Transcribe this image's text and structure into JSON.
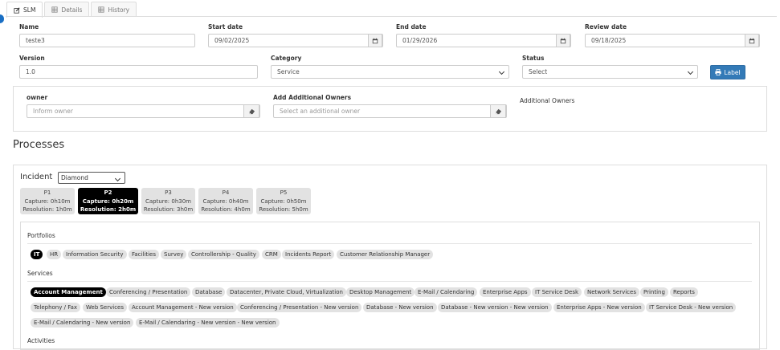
{
  "tabs": [
    {
      "label": "SLM",
      "icon": "edit-icon",
      "active": true
    },
    {
      "label": "Details",
      "icon": "list-icon",
      "active": false
    },
    {
      "label": "History",
      "icon": "list-icon",
      "active": false
    }
  ],
  "form": {
    "name": {
      "label": "Name",
      "value": "teste3"
    },
    "start_date": {
      "label": "Start date",
      "value": "09/02/2025"
    },
    "end_date": {
      "label": "End date",
      "value": "01/29/2026"
    },
    "review_date": {
      "label": "Review date",
      "value": "09/18/2025"
    },
    "version": {
      "label": "Version",
      "value": "1.0"
    },
    "category": {
      "label": "Category",
      "value": "Service"
    },
    "status": {
      "label": "Status",
      "value": "Select"
    },
    "label_button": "Label"
  },
  "owners": {
    "owner_label": "owner",
    "owner_placeholder": "Inform owner",
    "additional_label": "Add Additional Owners",
    "additional_placeholder": "Select an additional owner",
    "additional_owners_text": "Additional Owners"
  },
  "processes": {
    "title": "Processes",
    "incident_label": "Incident",
    "incident_select": "Diamond",
    "priorities": [
      {
        "name": "P1",
        "capture": "Capture: 0h10m",
        "resolution": "Resolution: 1h0m",
        "active": false
      },
      {
        "name": "P2",
        "capture": "Capture: 0h20m",
        "resolution": "Resolution: 2h0m",
        "active": true
      },
      {
        "name": "P3",
        "capture": "Capture: 0h30m",
        "resolution": "Resolution: 3h0m",
        "active": false
      },
      {
        "name": "P4",
        "capture": "Capture: 0h40m",
        "resolution": "Resolution: 4h0m",
        "active": false
      },
      {
        "name": "P5",
        "capture": "Capture: 0h50m",
        "resolution": "Resolution: 5h0m",
        "active": false
      }
    ],
    "portfolios_title": "Portfolios",
    "portfolios": [
      "IT",
      "HR",
      "Information Security",
      "Facilities",
      "Survey",
      "Controllership - Quality",
      "CRM",
      "Incidents Report",
      "Customer Relationship Manager"
    ],
    "services_title": "Services",
    "services": [
      "Account Management",
      "Conferencing / Presentation",
      "Database",
      "Datacenter, Private Cloud, Virtualization",
      "Desktop Management",
      "E-Mail / Calendaring",
      "Enterprise Apps",
      "IT Service Desk",
      "Network Services",
      "Printing",
      "Reports",
      "Telephony / Fax",
      "Web Services",
      "Account Management - New version",
      "Conferencing / Presentation - New version",
      "Database - New version",
      "Database - New version - New version",
      "Enterprise Apps - New version",
      "IT Service Desk - New version",
      "E-Mail / Calendaring - New version",
      "E-Mail / Calendaring - New version - New version"
    ],
    "activities_title": "Activities"
  }
}
